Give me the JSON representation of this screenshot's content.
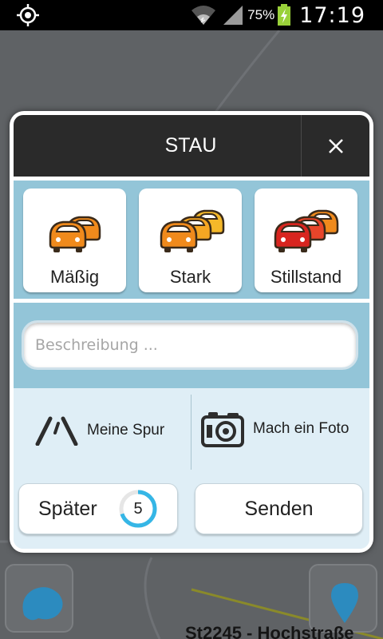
{
  "status_bar": {
    "battery_percent": "75%",
    "time": "17:19",
    "icons": [
      "gps-icon",
      "wifi-icon",
      "signal-icon",
      "battery-charging-icon"
    ]
  },
  "dialog": {
    "title": "STAU",
    "close_icon": "close-icon",
    "traffic_types": [
      {
        "label": "Mäßig",
        "icon": "cars-moderate-icon"
      },
      {
        "label": "Stark",
        "icon": "cars-heavy-icon"
      },
      {
        "label": "Stillstand",
        "icon": "cars-standstill-icon"
      }
    ],
    "description": {
      "placeholder": "Beschreibung ...",
      "value": ""
    },
    "options": {
      "lane_label": "Meine Spur",
      "lane_icon": "lane-icon",
      "photo_label": "Mach ein Foto",
      "photo_icon": "camera-icon"
    },
    "buttons": {
      "later_label": "Später",
      "countdown": "5",
      "countdown_progress": 0.7,
      "send_label": "Senden"
    }
  },
  "map": {
    "street_label": "St2245 - Hochstraße"
  },
  "colors": {
    "header_bg": "#2a2a2a",
    "panel_blue": "#93c5d8",
    "panel_light": "#dfeef6",
    "car_orange": "#f08a1c",
    "car_red": "#d8251f",
    "countdown_ring": "#35b6e6"
  }
}
